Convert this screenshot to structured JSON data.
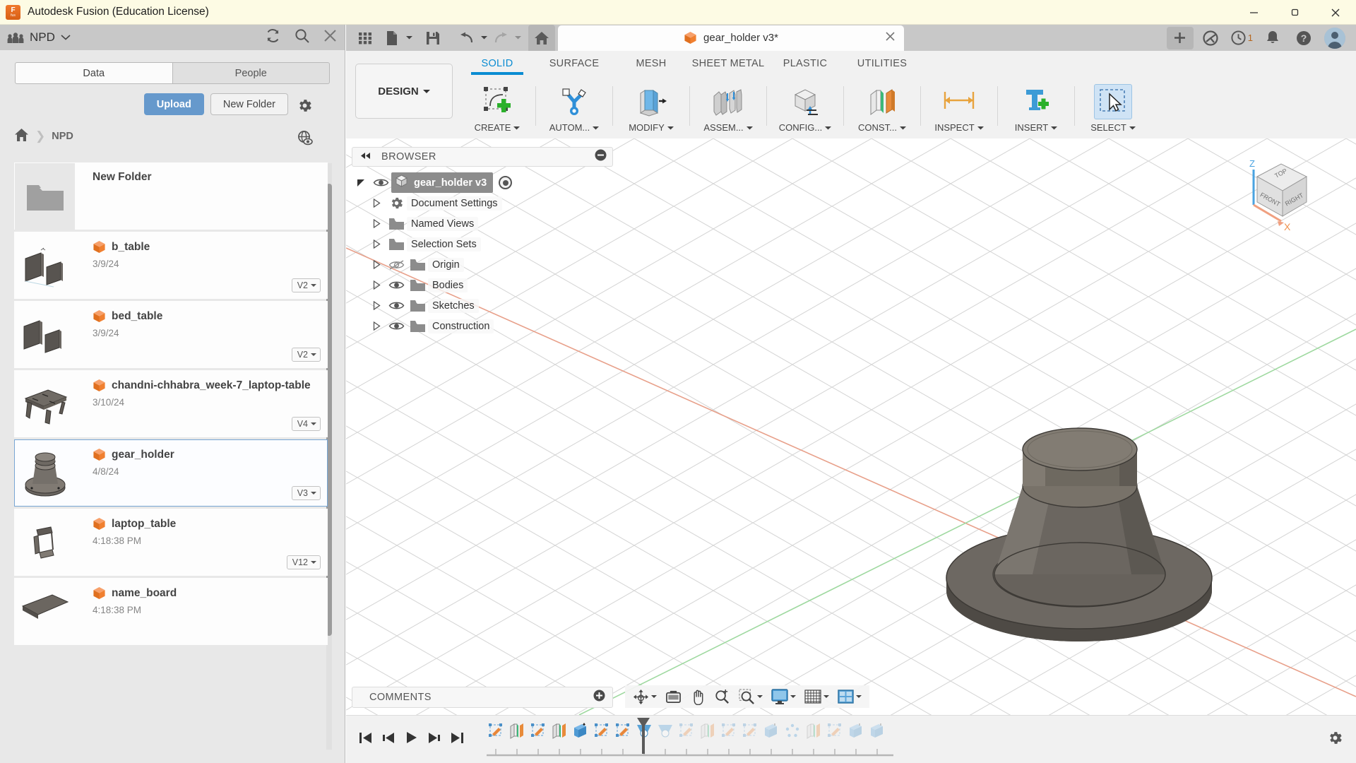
{
  "window": {
    "title": "Autodesk Fusion (Education License)",
    "logo_text_top": "F",
    "logo_text_bottom": "fus",
    "minimize_label": "Minimize",
    "maximize_label": "Restore",
    "close_label": "Close"
  },
  "data_panel": {
    "hub_name": "NPD",
    "people_icon": "people-icon",
    "refresh_icon": "refresh-icon",
    "search_icon": "search-icon",
    "close_icon": "close-icon",
    "tabs": [
      {
        "label": "Data",
        "active": true
      },
      {
        "label": "People",
        "active": false
      }
    ],
    "upload_label": "Upload",
    "new_folder_label": "New Folder",
    "settings_icon": "gear-icon",
    "globe_icon": "globe-eye-icon",
    "breadcrumb": {
      "home_icon": "home-icon",
      "separator": "❯",
      "current": "NPD"
    },
    "files": [
      {
        "name": "New Folder",
        "date": "",
        "version": "",
        "type": "folder",
        "selected": false
      },
      {
        "name": "b_table",
        "date": "3/9/24",
        "version": "V2",
        "type": "design",
        "selected": false
      },
      {
        "name": "bed_table",
        "date": "3/9/24",
        "version": "V2",
        "type": "design",
        "selected": false
      },
      {
        "name": "chandni-chhabra_week-7_laptop-table",
        "date": "3/10/24",
        "version": "V4",
        "type": "design",
        "selected": false
      },
      {
        "name": "gear_holder",
        "date": "4/8/24",
        "version": "V3",
        "type": "design",
        "selected": true
      },
      {
        "name": "laptop_table",
        "date": "4:18:38 PM",
        "version": "V12",
        "type": "design",
        "selected": false
      },
      {
        "name": "name_board",
        "date": "4:18:38 PM",
        "version": "",
        "type": "design",
        "selected": false
      }
    ]
  },
  "quick_access": {
    "grid_icon": "app-grid-icon",
    "new_icon": "new-document-icon",
    "save_icon": "save-icon",
    "undo_icon": "undo-icon",
    "redo_icon": "redo-icon",
    "home_icon": "home-tab-icon",
    "document_tab": {
      "label": "gear_holder v3*",
      "cube_icon": "orange-cube-icon",
      "close_icon": "close-tab-icon"
    },
    "add_tab_label": "+",
    "extension_icon": "extension-icon",
    "job_status_icon": "clock-icon",
    "job_status_count": "1",
    "notifications_icon": "bell-icon",
    "help_icon": "help-icon",
    "account_icon": "avatar"
  },
  "ribbon": {
    "workspace_label": "DESIGN",
    "tabs": [
      {
        "name": "SOLID",
        "active": true,
        "buttons": [
          {
            "label": "CREATE",
            "icon": "create-sketch-icon",
            "dropdown": true
          }
        ]
      },
      {
        "name": "SURFACE",
        "active": false,
        "buttons": [
          {
            "label": "AUTOM...",
            "icon": "automate-icon",
            "dropdown": true
          }
        ]
      },
      {
        "name": "MESH",
        "active": false,
        "buttons": [
          {
            "label": "MODIFY",
            "icon": "modify-mesh-icon",
            "dropdown": true
          }
        ]
      },
      {
        "name": "SHEET METAL",
        "active": false,
        "buttons": [
          {
            "label": "ASSEM...",
            "icon": "assemble-icon",
            "dropdown": true
          }
        ]
      },
      {
        "name": "PLASTIC",
        "active": false,
        "buttons": [
          {
            "label": "CONFIG...",
            "icon": "configure-icon",
            "dropdown": true
          }
        ]
      },
      {
        "name": "UTILITIES",
        "active": false,
        "buttons": [
          {
            "label": "CONST...",
            "icon": "construct-icon",
            "dropdown": true
          }
        ]
      }
    ],
    "trailing_buttons": [
      {
        "label": "INSPECT",
        "icon": "inspect-icon",
        "dropdown": true
      },
      {
        "label": "INSERT",
        "icon": "insert-icon",
        "dropdown": true
      },
      {
        "label": "SELECT",
        "icon": "select-icon",
        "dropdown": true,
        "highlighted": true
      }
    ]
  },
  "browser": {
    "title": "BROWSER",
    "collapse_icon": "collapse-left-icon",
    "minimize_icon": "minimize-panel-icon",
    "root": {
      "label": "gear_holder v3",
      "icon": "component-icon",
      "eye": "eye-visible-icon"
    },
    "items": [
      {
        "label": "Document Settings",
        "icon": "gear-icon",
        "eye": "none"
      },
      {
        "label": "Named Views",
        "icon": "folder-icon",
        "eye": "none"
      },
      {
        "label": "Selection Sets",
        "icon": "folder-icon",
        "eye": "none"
      },
      {
        "label": "Origin",
        "icon": "folder-icon",
        "eye": "eye-hidden-icon"
      },
      {
        "label": "Bodies",
        "icon": "folder-icon",
        "eye": "eye-visible-icon"
      },
      {
        "label": "Sketches",
        "icon": "folder-icon",
        "eye": "eye-visible-icon"
      },
      {
        "label": "Construction",
        "icon": "folder-icon",
        "eye": "eye-visible-icon"
      }
    ]
  },
  "viewcube": {
    "top_label": "TOP",
    "front_label": "FRONT",
    "right_label": "RIGHT",
    "axis_z": "Z",
    "axis_x": "X"
  },
  "comments": {
    "label": "COMMENTS",
    "add_icon": "add-comment-icon"
  },
  "view_tools": [
    {
      "name": "orbit-icon",
      "dropdown": true
    },
    {
      "name": "pan-view-icon",
      "dropdown": false
    },
    {
      "name": "pan-hand-icon",
      "dropdown": false
    },
    {
      "name": "zoom-icon",
      "dropdown": false
    },
    {
      "name": "zoom-window-icon",
      "dropdown": true
    },
    {
      "name": "display-settings-icon",
      "dropdown": true
    },
    {
      "name": "grid-snaps-icon",
      "dropdown": true
    },
    {
      "name": "viewports-icon",
      "dropdown": true
    }
  ],
  "timeline": {
    "playback": [
      {
        "name": "go-to-beginning-icon"
      },
      {
        "name": "step-back-icon"
      },
      {
        "name": "play-icon"
      },
      {
        "name": "step-forward-icon"
      },
      {
        "name": "go-to-end-icon"
      }
    ],
    "features": [
      {
        "name": "sketch-feature-icon",
        "state": "done"
      },
      {
        "name": "plastic-feature-icon",
        "state": "done"
      },
      {
        "name": "sketch-feature-icon",
        "state": "done"
      },
      {
        "name": "plastic-feature-icon",
        "state": "done"
      },
      {
        "name": "extrude-feature-icon",
        "state": "done"
      },
      {
        "name": "sketch-feature-icon",
        "state": "done"
      },
      {
        "name": "sketch-feature-icon",
        "state": "done"
      },
      {
        "name": "revolve-feature-icon",
        "state": "current"
      },
      {
        "name": "revolve-feature-icon",
        "state": "future"
      },
      {
        "name": "sketch-feature-icon",
        "state": "future"
      },
      {
        "name": "plastic-feature-icon",
        "state": "future"
      },
      {
        "name": "sketch-feature-icon",
        "state": "future"
      },
      {
        "name": "sketch-feature-icon",
        "state": "future"
      },
      {
        "name": "extrude-feature-icon",
        "state": "future"
      },
      {
        "name": "pattern-feature-icon",
        "state": "future"
      },
      {
        "name": "plastic-feature-icon",
        "state": "future"
      },
      {
        "name": "sketch-feature-icon",
        "state": "future"
      },
      {
        "name": "extrude-feature-icon",
        "state": "future"
      },
      {
        "name": "extrude-feature-icon",
        "state": "future"
      }
    ],
    "settings_icon": "gear-icon"
  },
  "colors": {
    "title_bar": "#fdfbe4",
    "accent_blue": "#0a8cd2",
    "upload_blue": "#6699cc",
    "orange": "#f0792c",
    "panel_gray": "#e8e8e8",
    "selection_blue": "#78a6d4"
  }
}
